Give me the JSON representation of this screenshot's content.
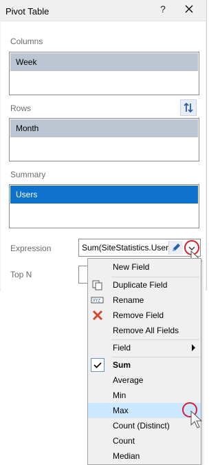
{
  "window": {
    "title": "Pivot Table",
    "help_label": "?"
  },
  "columns": {
    "label": "Columns",
    "items": [
      "Week"
    ]
  },
  "rows": {
    "label": "Rows",
    "items": [
      "Month"
    ]
  },
  "summary": {
    "label": "Summary",
    "items": [
      "Users"
    ]
  },
  "expression": {
    "label": "Expression",
    "value": "Sum(SiteStatistics.Users)"
  },
  "top_n": {
    "label": "Top N",
    "value": ""
  },
  "menu": {
    "new_field": "New Field",
    "duplicate_field": "Duplicate Field",
    "rename": "Rename",
    "remove_field": "Remove Field",
    "remove_all_fields": "Remove All Fields",
    "field": "Field",
    "functions": [
      "Sum",
      "Average",
      "Min",
      "Max",
      "Count (Distinct)",
      "Count",
      "Median"
    ],
    "checked": "Sum",
    "highlighted": "Max"
  },
  "colors": {
    "selection_gray": "#bcc6d2",
    "selection_blue": "#0e72cd",
    "highlight": "#cce8ff",
    "ring": "#d81e2a"
  }
}
